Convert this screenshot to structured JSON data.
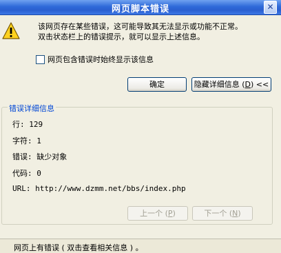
{
  "dialog": {
    "title": "网页脚本错误",
    "close_glyph": "✕",
    "message_line1": "该网页存在某些错误，这可能导致其无法显示或功能不正常。",
    "message_line2": "双击状态栏上的错误提示，就可以显示上述信息。",
    "checkbox_label": "网页包含错误时始终显示该信息",
    "checkbox_checked": false,
    "ok_label": "确定",
    "hide_details_label_prefix": "隐藏详细信息 (",
    "hide_details_key": "D",
    "hide_details_label_suffix": ") <<"
  },
  "details": {
    "group_title": "错误详细信息",
    "line_row": "行:  129",
    "char_row": "字符:  1",
    "error_row": "错误:  缺少对象",
    "code_row": "代码:  0",
    "url_row": "URL:  http://www.dzmm.net/bbs/index.php",
    "prev_label_prefix": "上一个 (",
    "prev_key": "P",
    "prev_label_suffix": ")",
    "next_label_prefix": "下一个 (",
    "next_key": "N",
    "next_label_suffix": ")"
  },
  "statusbar": {
    "text": "网页上有错误 ( 双击查看相关信息 ) 。"
  },
  "icons": {
    "warning": "warning-icon",
    "close": "close-icon"
  },
  "colors": {
    "title_bar": "#2f6ad9",
    "group_title": "#0046d5",
    "warning_fill": "#ffd21f"
  }
}
